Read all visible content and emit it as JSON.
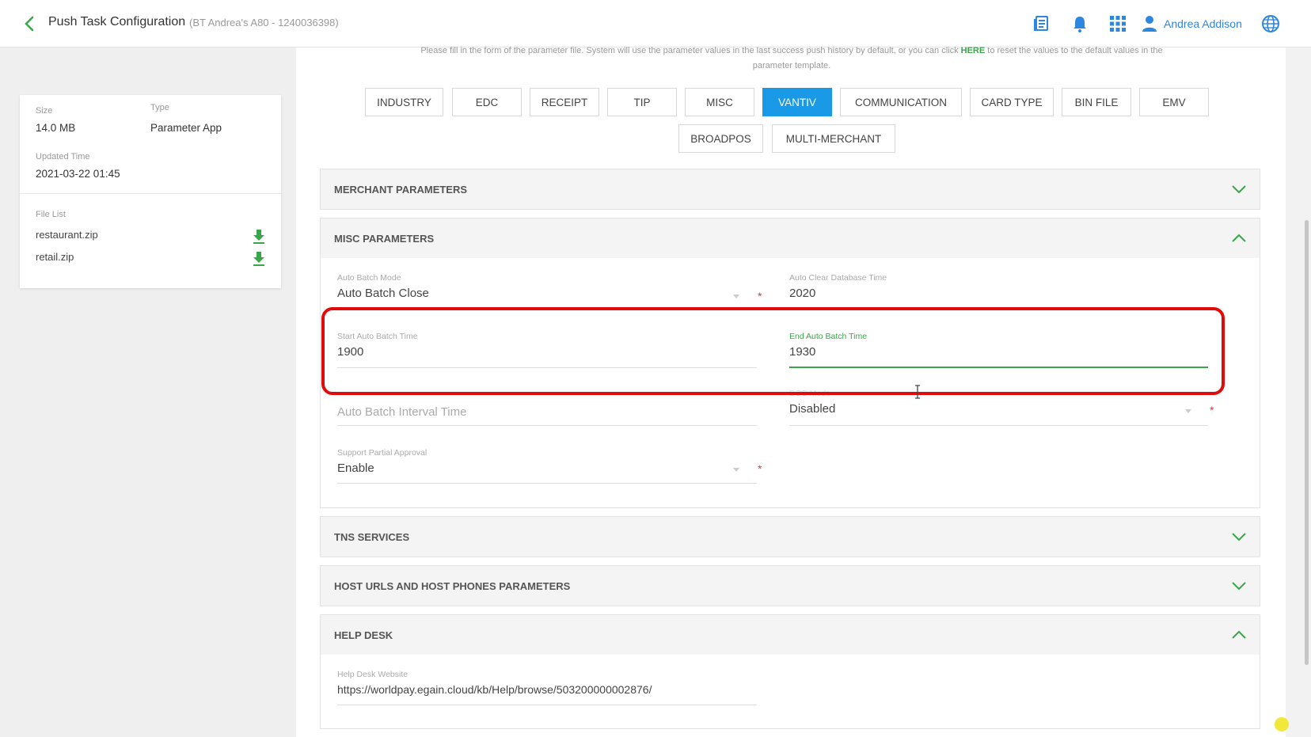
{
  "header": {
    "title": "Push Task Configuration",
    "subtitle": "(BT Andrea's A80 - 1240036398)",
    "user_name": "Andrea Addison"
  },
  "info_card": {
    "size_label": "Size",
    "size_value": "14.0 MB",
    "type_label": "Type",
    "type_value": "Parameter App",
    "updated_label": "Updated Time",
    "updated_value": "2021-03-22 01:45",
    "file_list_label": "File List",
    "files": [
      "restaurant.zip",
      "retail.zip"
    ]
  },
  "intro": {
    "line1_a": "Please fill in the form of the parameter file. System will use the parameter values in the last success push history by default, or you can click",
    "here": "HERE",
    "line1_b": "to reset the values to the default values in the",
    "line2": "parameter template."
  },
  "tabs": [
    "INDUSTRY",
    "EDC",
    "RECEIPT",
    "TIP",
    "MISC",
    "VANTIV",
    "COMMUNICATION",
    "CARD TYPE",
    "BIN FILE",
    "EMV",
    "BROADPOS",
    "MULTI-MERCHANT"
  ],
  "active_tab": "VANTIV",
  "sections": {
    "merchant": "MERCHANT PARAMETERS",
    "misc": "MISC PARAMETERS",
    "tns": "TNS SERVICES",
    "host": "HOST URLS AND HOST PHONES PARAMETERS",
    "helpdesk": "HELP DESK"
  },
  "misc_fields": {
    "auto_batch_mode_label": "Auto Batch Mode",
    "auto_batch_mode_value": "Auto Batch Close",
    "auto_clear_label": "Auto Clear Database Time",
    "auto_clear_value": "2020",
    "start_batch_label": "Start Auto Batch Time",
    "start_batch_value": "1900",
    "end_batch_label": "End Auto Batch Time",
    "end_batch_value": "1930",
    "interval_placeholder": "Auto Batch Interval Time",
    "dcc_label": "DCC Mode",
    "dcc_value": "Disabled",
    "partial_label": "Support Partial Approval",
    "partial_value": "Enable",
    "required_mark": "*"
  },
  "helpdesk_fields": {
    "website_label": "Help Desk Website",
    "website_value": "https://worldpay.egain.cloud/kb/Help/browse/503200000002876/"
  },
  "colors": {
    "accent_blue": "#1a9ae6",
    "accent_green": "#3aa64a",
    "highlight_red": "#e10b0b"
  }
}
